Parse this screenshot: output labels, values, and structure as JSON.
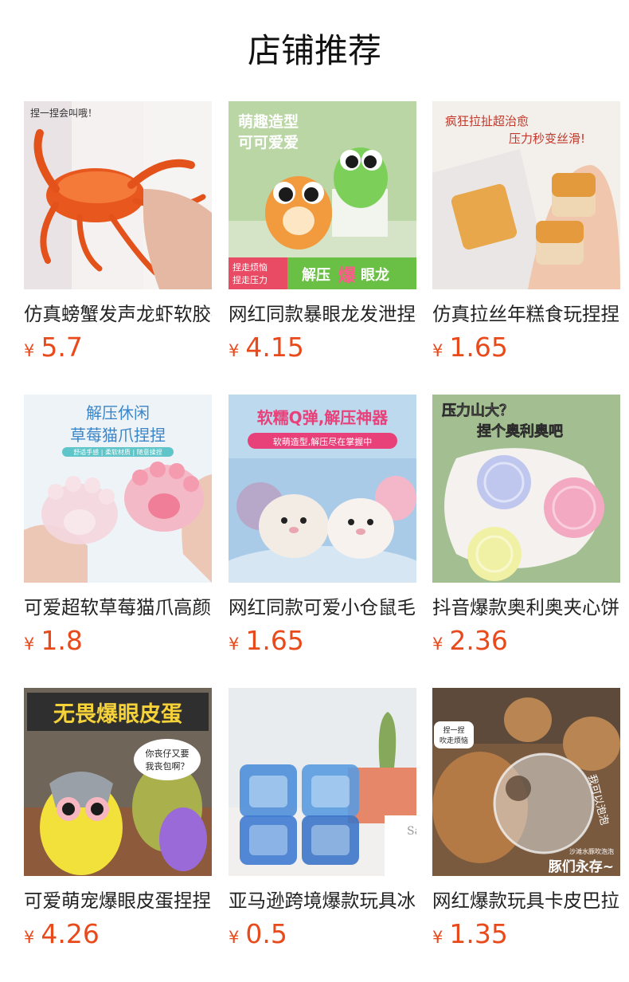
{
  "header": {
    "title": "店铺推荐"
  },
  "colors": {
    "price": "#e84a1c"
  },
  "products": [
    {
      "name": "仿真螃蟹发声龙虾软胶捏捏乐",
      "currency": "¥",
      "price": "5.7",
      "image_text": [
        "捏一捏会叫哦！"
      ],
      "image": "crab-squeeze-toy"
    },
    {
      "name": "网红同款暴眼龙发泄捏捏乐",
      "currency": "¥",
      "price": "4.15",
      "image_text": [
        "萌趣造型",
        "可可爱爱",
        "捏走烦恼",
        "捏走压力",
        "解压",
        "爆",
        "眼龙"
      ],
      "image": "bulging-eye-dragon-toys"
    },
    {
      "name": "仿真拉丝年糕食玩捏捏乐",
      "currency": "¥",
      "price": "1.65",
      "image_text": [
        "疯狂拉扯超治愈",
        "压力秒变丝滑!"
      ],
      "image": "rice-cake-squeeze-toy"
    },
    {
      "name": "可爱超软草莓猫爪高颜值捏捏",
      "currency": "¥",
      "price": "1.8",
      "image_text": [
        "解压休闲",
        "草莓猫爪捏捏",
        "舒适手感 | 柔软材质 | 随意揉捏"
      ],
      "image": "cat-paw-squeeze-toy"
    },
    {
      "name": "网红同款可爱小仓鼠毛绒捏捏",
      "currency": "¥",
      "price": "1.65",
      "image_text": [
        "软糯Q弹,解压神器",
        "软萌造型,解压尽在掌握中"
      ],
      "image": "hamster-plush-toys"
    },
    {
      "name": "抖音爆款奥利奥夹心饼干捏捏",
      "currency": "¥",
      "price": "2.36",
      "image_text": [
        "压力山大？",
        "捏个奥利奥吧"
      ],
      "image": "cookie-squeeze-toys"
    },
    {
      "name": "可爱萌宠爆眼皮蛋捏捏乐",
      "currency": "¥",
      "price": "4.26",
      "image_text": [
        "无畏爆眼皮蛋",
        "你丧仔又要",
        "我丧包啊？"
      ],
      "image": "bulging-eye-toy"
    },
    {
      "name": "亚马逊跨境爆款玩具冰块捏捏",
      "currency": "¥",
      "price": "0.5",
      "image_text": [
        "Sa"
      ],
      "image": "ice-cube-squeeze-toys"
    },
    {
      "name": "网红爆款玩具卡皮巴拉吹泡泡",
      "currency": "¥",
      "price": "1.35",
      "image_text": [
        "捏一捏",
        "吹走烦恼",
        "我可以泡泡",
        "沙滩水豚吹泡泡",
        "豚们永存~"
      ],
      "image": "capybara-bubble-toy"
    }
  ]
}
